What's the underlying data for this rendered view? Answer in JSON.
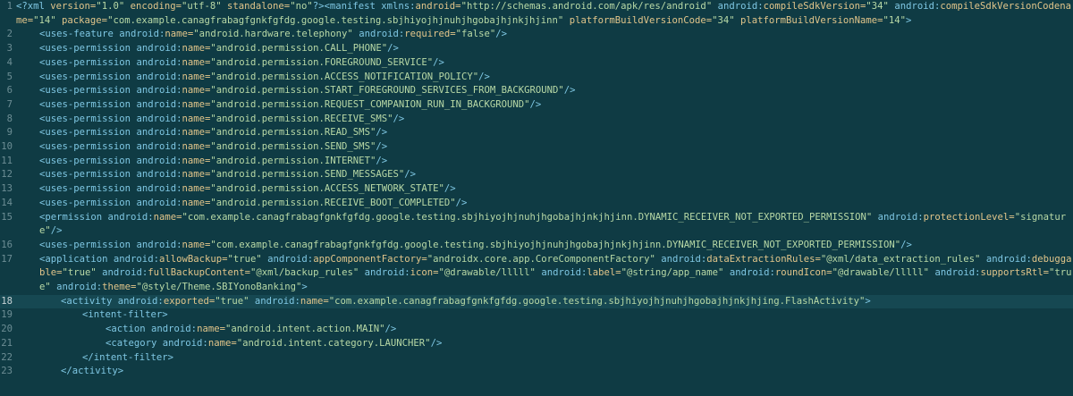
{
  "lines": [
    {
      "n": "1",
      "indent": 0,
      "segs": [
        {
          "t": "<?xml ",
          "c": "tag"
        },
        {
          "t": "version=",
          "c": "aname"
        },
        {
          "t": "\"1.0\"",
          "c": "str"
        },
        {
          "t": " encoding=",
          "c": "aname"
        },
        {
          "t": "\"utf-8\"",
          "c": "str"
        },
        {
          "t": " standalone=",
          "c": "aname"
        },
        {
          "t": "\"no\"",
          "c": "str"
        },
        {
          "t": "?>",
          "c": "tag"
        },
        {
          "t": "<manifest ",
          "c": "tag"
        },
        {
          "t": "xmlns:",
          "c": "ns"
        },
        {
          "t": "android=",
          "c": "aname"
        },
        {
          "t": "\"http://schemas.android.com/apk/res/android\"",
          "c": "str"
        },
        {
          "t": " android:",
          "c": "ns"
        },
        {
          "t": "compileSdkVersion=",
          "c": "aname"
        },
        {
          "t": "\"34\"",
          "c": "str"
        },
        {
          "t": " android:",
          "c": "ns"
        },
        {
          "t": "compileSdkVersionCodename=",
          "c": "aname"
        },
        {
          "t": "\"14\"",
          "c": "str"
        },
        {
          "t": " package=",
          "c": "aname"
        },
        {
          "t": "\"com.example.canagfrabagfgnkfgfdg.google.testing.sbjhiyojhjnuhjhgobajhjnkjhjinn\"",
          "c": "str"
        },
        {
          "t": " platformBuildVersionCode=",
          "c": "aname"
        },
        {
          "t": "\"34\"",
          "c": "str"
        },
        {
          "t": " platformBuildVersionName=",
          "c": "aname"
        },
        {
          "t": "\"14\"",
          "c": "str"
        },
        {
          "t": ">",
          "c": "tag"
        }
      ]
    },
    {
      "n": "2",
      "indent": 1,
      "segs": [
        {
          "t": "<uses-feature ",
          "c": "tag"
        },
        {
          "t": "android:",
          "c": "ns"
        },
        {
          "t": "name=",
          "c": "aname"
        },
        {
          "t": "\"android.hardware.telephony\"",
          "c": "str"
        },
        {
          "t": " android:",
          "c": "ns"
        },
        {
          "t": "required=",
          "c": "aname"
        },
        {
          "t": "\"false\"",
          "c": "str"
        },
        {
          "t": "/>",
          "c": "tag"
        }
      ]
    },
    {
      "n": "3",
      "indent": 1,
      "segs": [
        {
          "t": "<uses-permission ",
          "c": "tag"
        },
        {
          "t": "android:",
          "c": "ns"
        },
        {
          "t": "name=",
          "c": "aname"
        },
        {
          "t": "\"android.permission.CALL_PHONE\"",
          "c": "str"
        },
        {
          "t": "/>",
          "c": "tag"
        }
      ]
    },
    {
      "n": "4",
      "indent": 1,
      "segs": [
        {
          "t": "<uses-permission ",
          "c": "tag"
        },
        {
          "t": "android:",
          "c": "ns"
        },
        {
          "t": "name=",
          "c": "aname"
        },
        {
          "t": "\"android.permission.FOREGROUND_SERVICE\"",
          "c": "str"
        },
        {
          "t": "/>",
          "c": "tag"
        }
      ]
    },
    {
      "n": "5",
      "indent": 1,
      "segs": [
        {
          "t": "<uses-permission ",
          "c": "tag"
        },
        {
          "t": "android:",
          "c": "ns"
        },
        {
          "t": "name=",
          "c": "aname"
        },
        {
          "t": "\"android.permission.ACCESS_NOTIFICATION_POLICY\"",
          "c": "str"
        },
        {
          "t": "/>",
          "c": "tag"
        }
      ]
    },
    {
      "n": "6",
      "indent": 1,
      "segs": [
        {
          "t": "<uses-permission ",
          "c": "tag"
        },
        {
          "t": "android:",
          "c": "ns"
        },
        {
          "t": "name=",
          "c": "aname"
        },
        {
          "t": "\"android.permission.START_FOREGROUND_SERVICES_FROM_BACKGROUND\"",
          "c": "str"
        },
        {
          "t": "/>",
          "c": "tag"
        }
      ]
    },
    {
      "n": "7",
      "indent": 1,
      "segs": [
        {
          "t": "<uses-permission ",
          "c": "tag"
        },
        {
          "t": "android:",
          "c": "ns"
        },
        {
          "t": "name=",
          "c": "aname"
        },
        {
          "t": "\"android.permission.REQUEST_COMPANION_RUN_IN_BACKGROUND\"",
          "c": "str"
        },
        {
          "t": "/>",
          "c": "tag"
        }
      ]
    },
    {
      "n": "8",
      "indent": 1,
      "segs": [
        {
          "t": "<uses-permission ",
          "c": "tag"
        },
        {
          "t": "android:",
          "c": "ns"
        },
        {
          "t": "name=",
          "c": "aname"
        },
        {
          "t": "\"android.permission.RECEIVE_SMS\"",
          "c": "str"
        },
        {
          "t": "/>",
          "c": "tag"
        }
      ]
    },
    {
      "n": "9",
      "indent": 1,
      "segs": [
        {
          "t": "<uses-permission ",
          "c": "tag"
        },
        {
          "t": "android:",
          "c": "ns"
        },
        {
          "t": "name=",
          "c": "aname"
        },
        {
          "t": "\"android.permission.READ_SMS\"",
          "c": "str"
        },
        {
          "t": "/>",
          "c": "tag"
        }
      ]
    },
    {
      "n": "10",
      "indent": 1,
      "segs": [
        {
          "t": "<uses-permission ",
          "c": "tag"
        },
        {
          "t": "android:",
          "c": "ns"
        },
        {
          "t": "name=",
          "c": "aname"
        },
        {
          "t": "\"android.permission.SEND_SMS\"",
          "c": "str"
        },
        {
          "t": "/>",
          "c": "tag"
        }
      ]
    },
    {
      "n": "11",
      "indent": 1,
      "segs": [
        {
          "t": "<uses-permission ",
          "c": "tag"
        },
        {
          "t": "android:",
          "c": "ns"
        },
        {
          "t": "name=",
          "c": "aname"
        },
        {
          "t": "\"android.permission.INTERNET\"",
          "c": "str"
        },
        {
          "t": "/>",
          "c": "tag"
        }
      ]
    },
    {
      "n": "12",
      "indent": 1,
      "segs": [
        {
          "t": "<uses-permission ",
          "c": "tag"
        },
        {
          "t": "android:",
          "c": "ns"
        },
        {
          "t": "name=",
          "c": "aname"
        },
        {
          "t": "\"android.permission.SEND_MESSAGES\"",
          "c": "str"
        },
        {
          "t": "/>",
          "c": "tag"
        }
      ]
    },
    {
      "n": "13",
      "indent": 1,
      "segs": [
        {
          "t": "<uses-permission ",
          "c": "tag"
        },
        {
          "t": "android:",
          "c": "ns"
        },
        {
          "t": "name=",
          "c": "aname"
        },
        {
          "t": "\"android.permission.ACCESS_NETWORK_STATE\"",
          "c": "str"
        },
        {
          "t": "/>",
          "c": "tag"
        }
      ]
    },
    {
      "n": "14",
      "indent": 1,
      "segs": [
        {
          "t": "<uses-permission ",
          "c": "tag"
        },
        {
          "t": "android:",
          "c": "ns"
        },
        {
          "t": "name=",
          "c": "aname"
        },
        {
          "t": "\"android.permission.RECEIVE_BOOT_COMPLETED\"",
          "c": "str"
        },
        {
          "t": "/>",
          "c": "tag"
        }
      ]
    },
    {
      "n": "15",
      "indent": 1,
      "segs": [
        {
          "t": "<permission ",
          "c": "tag"
        },
        {
          "t": "android:",
          "c": "ns"
        },
        {
          "t": "name=",
          "c": "aname"
        },
        {
          "t": "\"com.example.canagfrabagfgnkfgfdg.google.testing.sbjhiyojhjnuhjhgobajhjnkjhjinn.DYNAMIC_RECEIVER_NOT_EXPORTED_PERMISSION\"",
          "c": "str"
        },
        {
          "t": " android:",
          "c": "ns"
        },
        {
          "t": "protectionLevel=",
          "c": "aname"
        },
        {
          "t": "\"signature\"",
          "c": "str"
        },
        {
          "t": "/>",
          "c": "tag"
        }
      ]
    },
    {
      "n": "16",
      "indent": 1,
      "segs": [
        {
          "t": "<uses-permission ",
          "c": "tag"
        },
        {
          "t": "android:",
          "c": "ns"
        },
        {
          "t": "name=",
          "c": "aname"
        },
        {
          "t": "\"com.example.canagfrabagfgnkfgfdg.google.testing.sbjhiyojhjnuhjhgobajhjnkjhjinn.DYNAMIC_RECEIVER_NOT_EXPORTED_PERMISSION\"",
          "c": "str"
        },
        {
          "t": "/>",
          "c": "tag"
        }
      ]
    },
    {
      "n": "17",
      "indent": 1,
      "segs": [
        {
          "t": "<application ",
          "c": "tag"
        },
        {
          "t": "android:",
          "c": "ns"
        },
        {
          "t": "allowBackup=",
          "c": "aname"
        },
        {
          "t": "\"true\"",
          "c": "str"
        },
        {
          "t": " android:",
          "c": "ns"
        },
        {
          "t": "appComponentFactory=",
          "c": "aname"
        },
        {
          "t": "\"androidx.core.app.CoreComponentFactory\"",
          "c": "str"
        },
        {
          "t": " android:",
          "c": "ns"
        },
        {
          "t": "dataExtractionRules=",
          "c": "aname"
        },
        {
          "t": "\"@xml/data_extraction_rules\"",
          "c": "str"
        },
        {
          "t": " android:",
          "c": "ns"
        },
        {
          "t": "debuggable=",
          "c": "aname"
        },
        {
          "t": "\"true\"",
          "c": "str"
        },
        {
          "t": " android:",
          "c": "ns"
        },
        {
          "t": "fullBackupContent=",
          "c": "aname"
        },
        {
          "t": "\"@xml/backup_rules\"",
          "c": "str"
        },
        {
          "t": " android:",
          "c": "ns"
        },
        {
          "t": "icon=",
          "c": "aname"
        },
        {
          "t": "\"@drawable/lllll\"",
          "c": "str"
        },
        {
          "t": " android:",
          "c": "ns"
        },
        {
          "t": "label=",
          "c": "aname"
        },
        {
          "t": "\"@string/app_name\"",
          "c": "str"
        },
        {
          "t": " android:",
          "c": "ns"
        },
        {
          "t": "roundIcon=",
          "c": "aname"
        },
        {
          "t": "\"@drawable/lllll\"",
          "c": "str"
        },
        {
          "t": " android:",
          "c": "ns"
        },
        {
          "t": "supportsRtl=",
          "c": "aname"
        },
        {
          "t": "\"true\"",
          "c": "str"
        },
        {
          "t": " android:",
          "c": "ns"
        },
        {
          "t": "theme=",
          "c": "aname"
        },
        {
          "t": "\"@style/Theme.SBIYonoBanking\"",
          "c": "str"
        },
        {
          "t": ">",
          "c": "tag"
        }
      ]
    },
    {
      "n": "18",
      "indent": 2,
      "active": true,
      "segs": [
        {
          "t": "<activity ",
          "c": "tag"
        },
        {
          "t": "android:",
          "c": "ns"
        },
        {
          "t": "exported=",
          "c": "aname"
        },
        {
          "t": "\"true\"",
          "c": "str"
        },
        {
          "t": " android:",
          "c": "ns"
        },
        {
          "t": "name=",
          "c": "aname"
        },
        {
          "t": "\"com.example.canagfrabagfgnkfgfdg.google.testing.sbjhiyojhjnuhjhgobajhjnkjhjing.FlashActivity\"",
          "c": "str"
        },
        {
          "t": ">",
          "c": "tag"
        }
      ]
    },
    {
      "n": "19",
      "indent": 3,
      "segs": [
        {
          "t": "<intent-filter>",
          "c": "tag"
        }
      ]
    },
    {
      "n": "20",
      "indent": 4,
      "segs": [
        {
          "t": "<action ",
          "c": "tag"
        },
        {
          "t": "android:",
          "c": "ns"
        },
        {
          "t": "name=",
          "c": "aname"
        },
        {
          "t": "\"android.intent.action.MAIN\"",
          "c": "str"
        },
        {
          "t": "/>",
          "c": "tag"
        }
      ]
    },
    {
      "n": "21",
      "indent": 4,
      "segs": [
        {
          "t": "<category ",
          "c": "tag"
        },
        {
          "t": "android:",
          "c": "ns"
        },
        {
          "t": "name=",
          "c": "aname"
        },
        {
          "t": "\"android.intent.category.LAUNCHER\"",
          "c": "str"
        },
        {
          "t": "/>",
          "c": "tag"
        }
      ]
    },
    {
      "n": "22",
      "indent": 3,
      "segs": [
        {
          "t": "</intent-filter>",
          "c": "tag"
        }
      ]
    },
    {
      "n": "23",
      "indent": 2,
      "segs": [
        {
          "t": "</activity>",
          "c": "tag"
        }
      ]
    }
  ],
  "colors": {
    "background": "#0f3b44",
    "active_line": "#164852",
    "tag": "#7fc7e3",
    "attribute": "#e1c58a",
    "string": "#b8d9a6",
    "line_number": "#6d8e95"
  }
}
